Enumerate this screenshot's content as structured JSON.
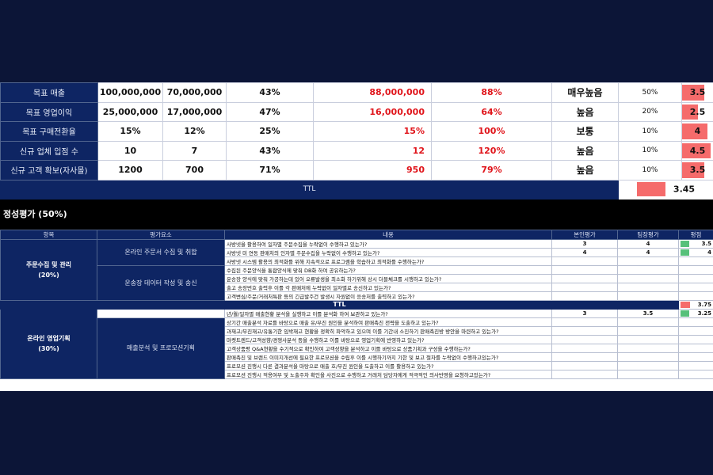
{
  "quant_rows": [
    {
      "label": "목표 매출",
      "target": "100,000,000",
      "previous": "70,000,000",
      "growth": "43%",
      "actual": "88,000,000",
      "rate": "88%",
      "grade": "매우높음",
      "weight": "50%",
      "score": "3.5",
      "score_value": 3.5
    },
    {
      "label": "목표 영업이익",
      "target": "25,000,000",
      "previous": "17,000,000",
      "growth": "47%",
      "actual": "16,000,000",
      "rate": "64%",
      "grade": "높음",
      "weight": "20%",
      "score": "2.5",
      "score_value": 2.5
    },
    {
      "label": "목표 구매전환율",
      "target": "15%",
      "previous": "12%",
      "growth": "25%",
      "actual": "15%",
      "rate": "100%",
      "grade": "보통",
      "weight": "10%",
      "score": "4",
      "score_value": 4
    },
    {
      "label": "신규 업체 입점 수",
      "target": "10",
      "previous": "7",
      "growth": "43%",
      "actual": "12",
      "rate": "120%",
      "grade": "높음",
      "weight": "10%",
      "score": "4.5",
      "score_value": 4.5
    },
    {
      "label": "신규 고객 확보(자사몰)",
      "target": "1200",
      "previous": "700",
      "growth": "71%",
      "actual": "950",
      "rate": "79%",
      "grade": "높음",
      "weight": "10%",
      "score": "3.5",
      "score_value": 3.5
    }
  ],
  "quant_ttl": {
    "label": "TTL",
    "score": "3.45"
  },
  "qual_title": "정성평가 (50%)",
  "qual_headers": {
    "category": "항목",
    "element": "평가요소",
    "content": "내용",
    "self": "본인평가",
    "leader": "팀장평가",
    "score": "평점"
  },
  "qual_cat1": {
    "name": "주문수집 및 관리",
    "weight": "(20%)"
  },
  "qual_cat2": {
    "name": "온라인 영업기획",
    "weight": "(30%)"
  },
  "qual_elements": {
    "e1": "온라인 주문서 수집 및 취합",
    "e2": "운송장 데이터 작성 및 송신",
    "e3": "매출분석 및 프로모션기획"
  },
  "qual_rows": [
    {
      "q": "사방넷을 활용하여 일자별 주문수집을 누락없이 수행하고 있는가?",
      "self": "3",
      "leader": "4",
      "score": "3.5"
    },
    {
      "q": "사방넷 미 연동 판매처의 인자별 주문수집을 누락없이 수행하고 있는가?",
      "self": "4",
      "leader": "4",
      "score": "4"
    },
    {
      "q": "사방넷 시스템 활용의 최적화를 위해 지속적으로 프로그램을 학습하고 최적화를 수행하는가?",
      "self": "",
      "leader": "",
      "score": ""
    },
    {
      "q": "수집된 주문양식을 통합양식에 맞춰 DB화 하여 공유하는가?",
      "self": "",
      "leader": "",
      "score": ""
    },
    {
      "q": "운송장 양식에 맞춰 가공하는데 있어 오류발생을 최소화 하기위해 상시 더블체크를 시행하고 있는가?",
      "self": "",
      "leader": "",
      "score": ""
    },
    {
      "q": "출고 송장번호 출력후 이를 각 판매처에 누락없이 일자별로 송신하고 있는가?",
      "self": "",
      "leader": "",
      "score": ""
    },
    {
      "q": "고객변심/주문/거래처특판 등의 긴급발주건 발생시 자원없이 응송처를 출력하고 있는가?",
      "self": "",
      "leader": "",
      "score": ""
    }
  ],
  "qual_ttl": {
    "label": "TTL",
    "score": "3.75"
  },
  "qual_rows2": [
    {
      "q": "년/월/일자별 매출현황 분석을 실행하고 이를 분석화 하여 보관하고 있는가?",
      "self": "3",
      "leader": "3.5",
      "score": "3.25"
    },
    {
      "q": "상기간 매출분석 자료를 바탕으로 매출 유/부진 원인을 분석하여 판매촉진 전략을 도출하고 있는가?",
      "self": "",
      "leader": "",
      "score": ""
    },
    {
      "q": "과재고/부진재고/유통기한 임박재고 현황을 정확히 파악하고 있으며 이를 기간내 소진하기 판매촉진방 방안을 마련하고 있는가?",
      "self": "",
      "leader": "",
      "score": ""
    },
    {
      "q": "마켓트렌드/고객성향/경쟁사분석 등을 수행하고 이를 바탕으로 영업기획에 반영하고 있는가?",
      "self": "",
      "leader": "",
      "score": ""
    },
    {
      "q": "고객상품평 Q&A현황을 수기적으로 확인하여 고객성향을 분석하고 이를 바탕으로 상품기획과 구성을 수행하는가?",
      "self": "",
      "leader": "",
      "score": ""
    },
    {
      "q": "판매촉진 및 브랜드 이미지개선에 필요한 프로모션을 수립후 이를 시행하기까지 기한 및 보고 절차를 누락없이 수행하고있는가?",
      "self": "",
      "leader": "",
      "score": ""
    },
    {
      "q": "프로모션 진행시 다른 결과분석을 마탕으로 매출 호/부진 원인을 도출하고 이를 활용하고 있는가?",
      "self": "",
      "leader": "",
      "score": ""
    },
    {
      "q": "프로모션 진행시 적용여부 및 노출주차 확인을 사진으로 수행하고 거래처 담당자에게 적극적인 의사반영을 요청하고있는가?",
      "self": "",
      "leader": "",
      "score": ""
    }
  ],
  "colors": {
    "navy": "#0e2563",
    "red": "#e0151b",
    "score_bar": "#f56b6b",
    "green": "#57c07a"
  }
}
